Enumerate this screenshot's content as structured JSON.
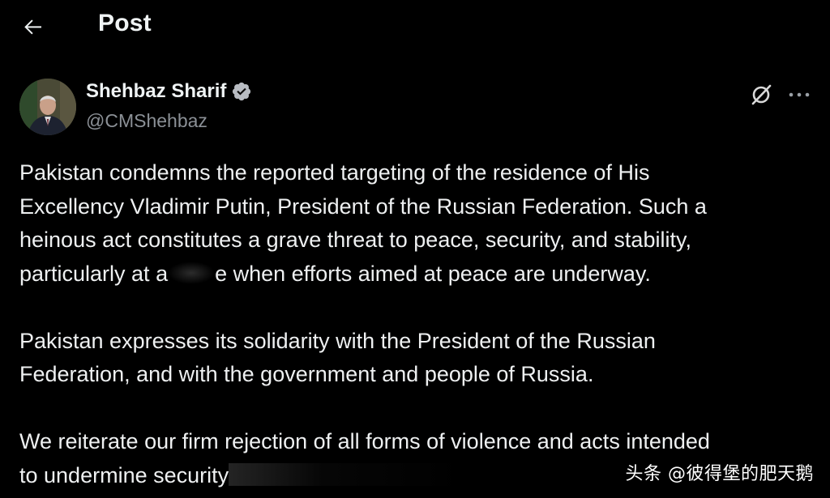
{
  "header": {
    "title": "Post",
    "back_icon": "arrow-left-icon"
  },
  "author": {
    "name": "Shehbaz Sharif",
    "handle": "@CMShehbaz",
    "verified": true,
    "verified_color": "#1d9bf0"
  },
  "actions": {
    "grok_icon": "grok-icon",
    "more_icon": "more-horizontal-icon"
  },
  "post": {
    "lines": [
      "Pakistan condemns the reported targeting of the residence of His",
      "Excellency Vladimir Putin, President of the Russian Federation. Such a",
      "heinous act constitutes a grave threat to peace, security, and stability,",
      "particularly at a",
      "e when efforts aimed at peace are underway.",
      "Pakistan expresses its solidarity with the President of the Russian",
      "Federation, and with the government and people of Russia.",
      "We reiterate our firm rejection of all forms of violence and acts intended",
      "to undermine security"
    ]
  },
  "watermark": "头条 @彼得堡的肥天鹅",
  "colors": {
    "background": "#000000",
    "text": "#e7e9ea",
    "secondary_text": "#71767b"
  }
}
